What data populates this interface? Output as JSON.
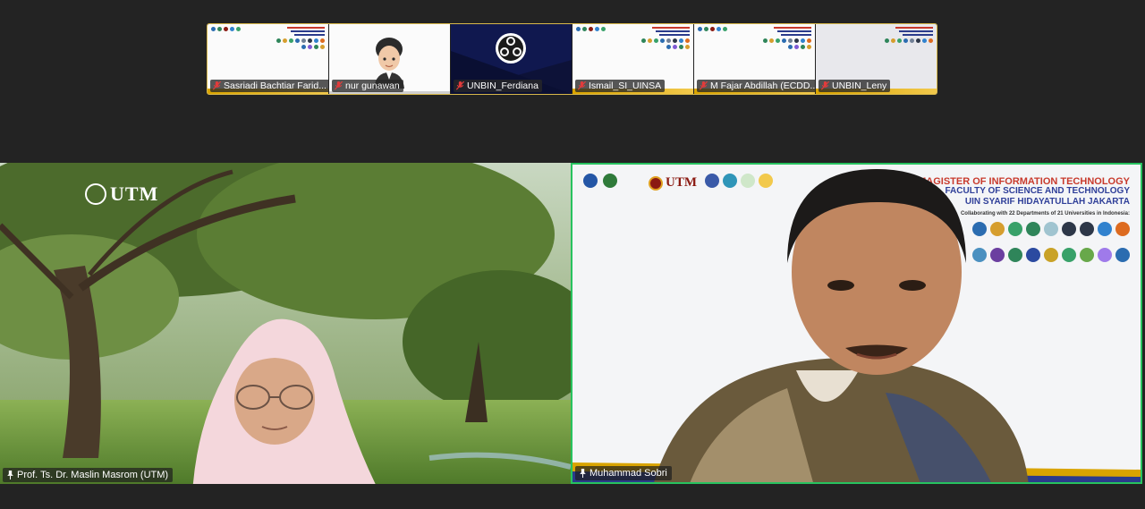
{
  "thumbnails": [
    {
      "name": "Sasriadi Bachtiar Farid...",
      "type": "slide"
    },
    {
      "name": "nur gunawan",
      "type": "avatar"
    },
    {
      "name": "UNBIN_Ferdiana",
      "type": "obs"
    },
    {
      "name": "Ismail_SI_UINSA",
      "type": "slide"
    },
    {
      "name": "M Fajar Abdillah (ECDD...",
      "type": "slide"
    },
    {
      "name": "UNBIN_Leny",
      "type": "grey-slide"
    }
  ],
  "main": {
    "left": {
      "name": "Prof. Ts. Dr. Maslin Masrom (UTM)",
      "background_brand": "UTM"
    },
    "right": {
      "name": "Muhammad Sobri",
      "slide": {
        "title": "MAGISTER OF INFORMATION TECHNOLOGY",
        "faculty": "FACULTY OF SCIENCE AND TECHNOLOGY",
        "university": "UIN SYARIF HIDAYATULLAH JAKARTA",
        "collab": "Collaborating with 22 Departments of 21 Universities in Indonesia:",
        "brand": "UTM"
      }
    }
  },
  "colors": {
    "active_speaker_border": "#27c25f",
    "strip_border": "#d8b84a",
    "background": "#232323",
    "muted_mic": "#e23b3b"
  },
  "icons": {
    "muted": "mic-muted-icon",
    "pinned": "pin-icon"
  }
}
